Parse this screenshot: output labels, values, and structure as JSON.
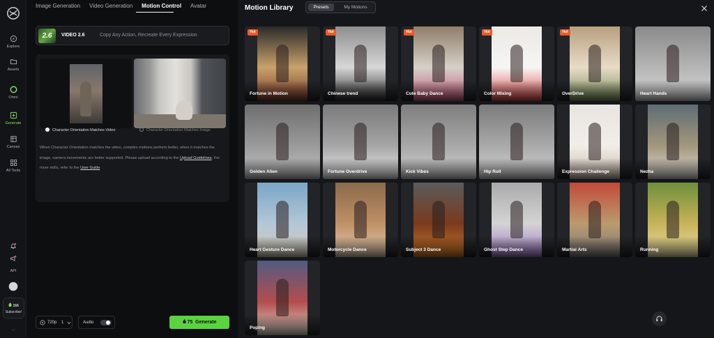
{
  "rail": {
    "items": [
      {
        "label": "Explore"
      },
      {
        "label": "Assets"
      },
      {
        "label": "Omni"
      },
      {
        "label": "Generate"
      },
      {
        "label": "Canvas"
      },
      {
        "label": "All Tools"
      }
    ],
    "api_label": "API",
    "credits": "166",
    "subscribe_label": "Subscribe!",
    "more_label": "...",
    "accent": "#7ee35b"
  },
  "left": {
    "tabs": [
      "Image Generation",
      "Video Generation",
      "Motion Control",
      "Avatar"
    ],
    "active_tab": "Motion Control",
    "model": {
      "badge": "2.6",
      "name": "VIDEO 2.6",
      "tagline": "Copy Any Action, Recreate Every Expression"
    },
    "options": {
      "video": "Character Orientation Matches Video",
      "image": "Character Orientation Matches Image"
    },
    "hint": {
      "text1": "When Character Orientation matches the video, complex motions perform better, when it matches the image, camera movements are better supported. Please upload according to the ",
      "link1": "Upload Guidelines",
      "text2": ". For more skills, refer to the ",
      "link2": "User Guide"
    },
    "resolution": "720p",
    "count": "1",
    "audio_label": "Audio",
    "generate": {
      "cost": "75",
      "label": "Generate",
      "color": "#5bd33e"
    }
  },
  "library": {
    "title": "Motion Library",
    "segments": [
      "Presets",
      "My Motions"
    ],
    "active_segment": "Presets",
    "hot_label": "Hot",
    "cards": [
      {
        "name": "Fortune in Motion",
        "hot": true
      },
      {
        "name": "Chinese trend",
        "hot": true
      },
      {
        "name": "Cute Baby Dance",
        "hot": true
      },
      {
        "name": "Color Mixing",
        "hot": true
      },
      {
        "name": "OverDrive",
        "hot": true
      },
      {
        "name": "Heart Hands",
        "hot": false
      },
      {
        "name": "Golden Alien",
        "hot": false
      },
      {
        "name": "Fortune Overdrive",
        "hot": false
      },
      {
        "name": "Kick Vibes",
        "hot": false
      },
      {
        "name": "Hip Roll",
        "hot": false
      },
      {
        "name": "Expression Challenge",
        "hot": false
      },
      {
        "name": "Nezha",
        "hot": false
      },
      {
        "name": "Heart Gesture Dance",
        "hot": false
      },
      {
        "name": "Motorcycle Dance",
        "hot": false
      },
      {
        "name": "Subject 3 Dance",
        "hot": false
      },
      {
        "name": "Ghost Step Dance",
        "hot": false
      },
      {
        "name": "Martial Arts",
        "hot": false
      },
      {
        "name": "Running",
        "hot": false
      },
      {
        "name": "Poping",
        "hot": false
      }
    ]
  }
}
